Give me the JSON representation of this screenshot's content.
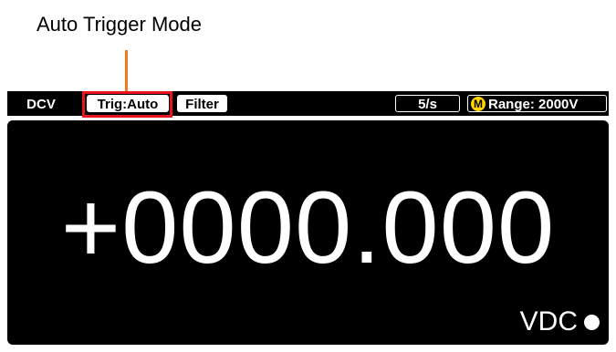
{
  "callout": {
    "label": "Auto Trigger Mode",
    "line_color": "#f07a22",
    "highlight_color": "#e8141e"
  },
  "status_bar": {
    "function": "DCV",
    "trigger": "Trig:Auto",
    "filter": "Filter",
    "rate": "5/s",
    "manual_badge": "M",
    "range": "Range: 2000V"
  },
  "display": {
    "reading": "+0000.000",
    "unit": "VDC"
  },
  "colors": {
    "background": "#000000",
    "text": "#ffffff",
    "badge": "#ffd400"
  }
}
